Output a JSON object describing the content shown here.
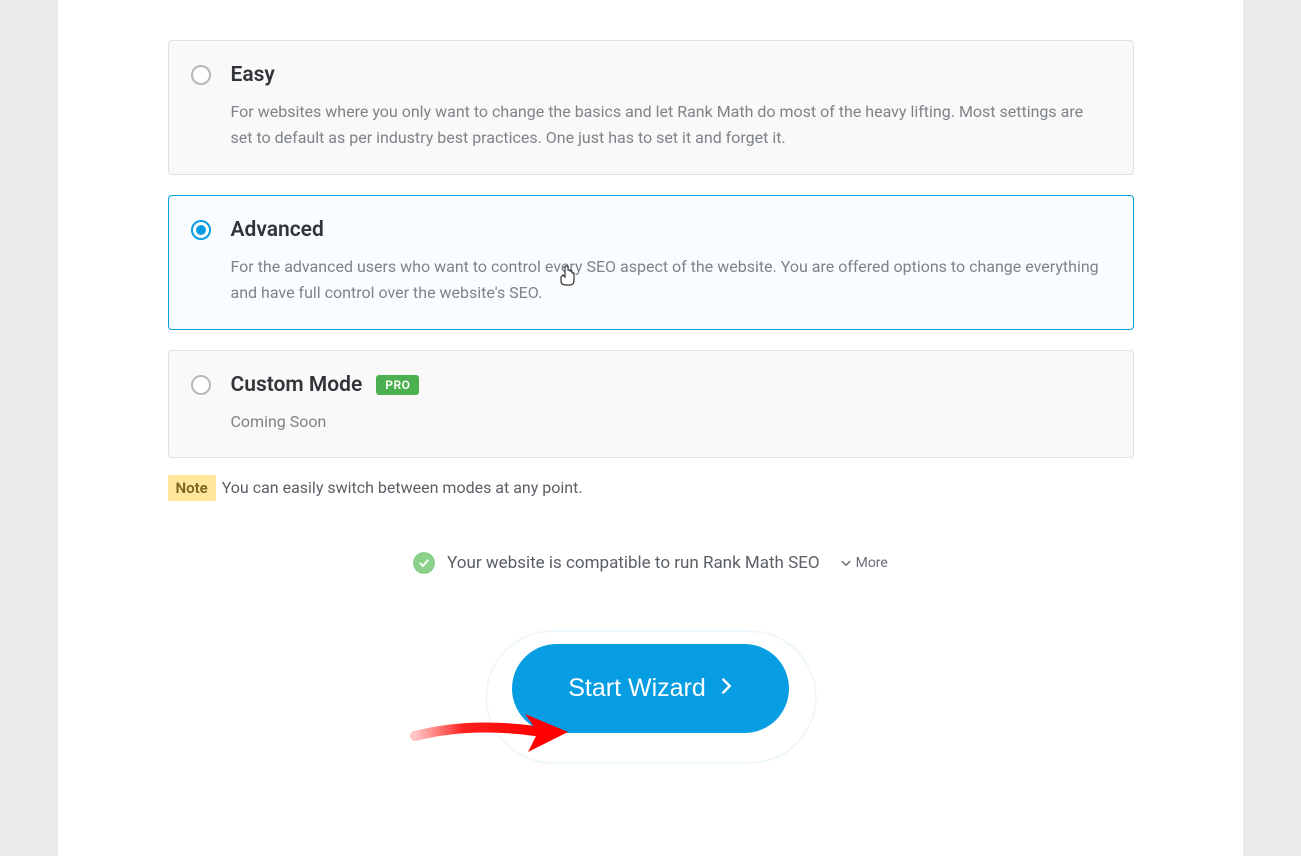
{
  "options": {
    "easy": {
      "title": "Easy",
      "description": "For websites where you only want to change the basics and let Rank Math do most of the heavy lifting. Most settings are set to default as per industry best practices. One just has to set it and forget it."
    },
    "advanced": {
      "title": "Advanced",
      "description": "For the advanced users who want to control every SEO aspect of the website. You are offered options to change everything and have full control over the website's SEO."
    },
    "custom": {
      "title": "Custom Mode",
      "badge": "PRO",
      "description": "Coming Soon"
    }
  },
  "note": {
    "label": "Note",
    "text": " You can easily switch between modes at any point."
  },
  "compatibility": {
    "text": "Your website is compatible to run Rank Math SEO",
    "more": "More"
  },
  "button": {
    "label": "Start Wizard"
  }
}
